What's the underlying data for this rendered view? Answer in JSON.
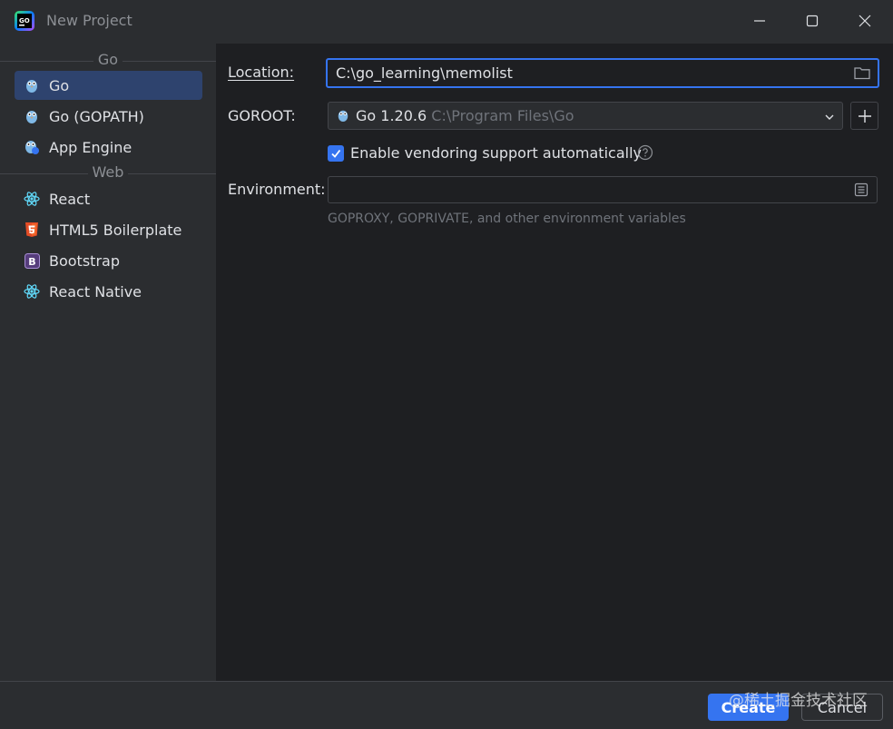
{
  "window": {
    "title": "New Project"
  },
  "colors": {
    "accent": "#3574f0",
    "selected_bg": "#2e436e",
    "background": "#1e1f22"
  },
  "sidebar": {
    "groups": [
      {
        "label": "Go"
      },
      {
        "label": "Web"
      }
    ],
    "items": [
      {
        "label": "Go",
        "icon": "gopher-icon",
        "selected": true
      },
      {
        "label": "Go (GOPATH)",
        "icon": "gopher-icon"
      },
      {
        "label": "App Engine",
        "icon": "app-engine-icon"
      },
      {
        "label": "React",
        "icon": "react-icon"
      },
      {
        "label": "HTML5 Boilerplate",
        "icon": "html5-icon"
      },
      {
        "label": "Bootstrap",
        "icon": "bootstrap-icon"
      },
      {
        "label": "React Native",
        "icon": "react-icon"
      }
    ]
  },
  "form": {
    "location_label": "Location:",
    "location_value": "C:\\go_learning\\memolist",
    "goroot_label": "GOROOT:",
    "goroot_version": "Go 1.20.6",
    "goroot_path": "C:\\Program Files\\Go",
    "vendoring_label": "Enable vendoring support automatically",
    "vendoring_checked": true,
    "environment_label": "Environment:",
    "environment_value": "",
    "environment_hint": "GOPROXY, GOPRIVATE, and other environment variables"
  },
  "footer": {
    "create_label": "Create",
    "cancel_label": "Cancel",
    "watermark": "@稀土掘金技术社区"
  }
}
